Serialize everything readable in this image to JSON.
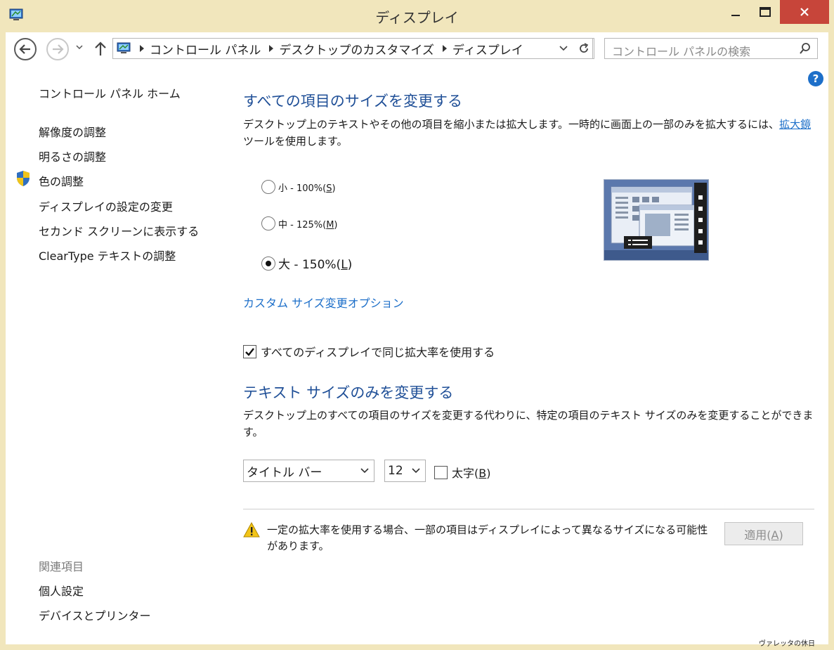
{
  "window": {
    "title": "ディスプレイ"
  },
  "nav": {
    "breadcrumbs": [
      "コントロール パネル",
      "デスクトップのカスタマイズ",
      "ディスプレイ"
    ],
    "search_placeholder": "コントロール パネルの検索"
  },
  "sidebar": {
    "home": "コントロール パネル ホーム",
    "items": [
      "解像度の調整",
      "明るさの調整",
      "色の調整",
      "ディスプレイの設定の変更",
      "セカンド スクリーンに表示する",
      "ClearType テキストの調整"
    ],
    "related_heading": "関連項目",
    "related": [
      "個人設定",
      "デバイスとプリンター"
    ]
  },
  "main": {
    "resize_heading": "すべての項目のサイズを変更する",
    "resize_desc_before": "デスクトップ上のテキストやその他の項目を縮小または拡大します。一時的に画面上の一部のみを拡大するには、",
    "resize_desc_link": "拡大鏡",
    "resize_desc_after": "ツールを使用します。",
    "options": [
      {
        "label": "小 - 100%(",
        "key": "S",
        "selected": false
      },
      {
        "label": "中 - 125%(",
        "key": "M",
        "selected": false
      },
      {
        "label": "大 - 150%(",
        "key": "L",
        "selected": true
      }
    ],
    "custom_link": "カスタム サイズ変更オプション",
    "same_scale_label": "すべてのディスプレイで同じ拡大率を使用する",
    "same_scale_checked": true,
    "text_heading": "テキスト サイズのみを変更する",
    "text_desc": "デスクトップ上のすべての項目のサイズを変更する代わりに、特定の項目のテキスト サイズのみを変更することができます。",
    "item_select": "タイトル バー",
    "size_select": "12",
    "bold_label": "太字(",
    "bold_key": "B",
    "bold_checked": false,
    "warning": "一定の拡大率を使用する場合、一部の項目はディスプレイによって異なるサイズになる可能性があります。",
    "apply_label": "適用(",
    "apply_key": "A"
  },
  "watermark": "ヴァレッタの休日",
  "colors": {
    "frame": "#f1e6bc",
    "close": "#c7453a",
    "heading": "#1f4f97",
    "link": "#1d6fc9"
  }
}
